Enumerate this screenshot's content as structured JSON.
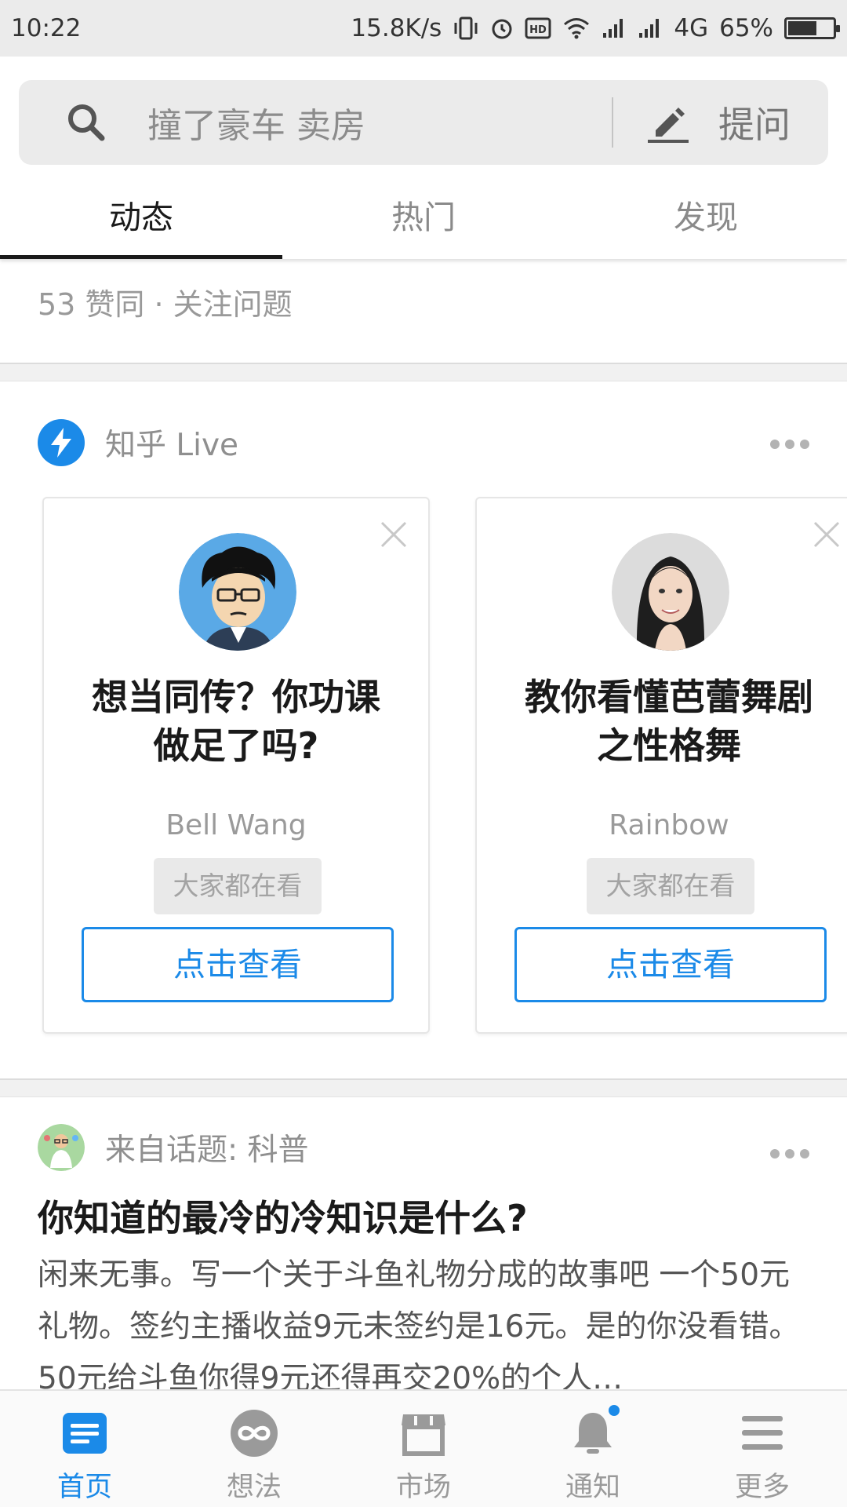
{
  "status_bar": {
    "time": "10:22",
    "speed": "15.8K/s",
    "network": "4G",
    "battery": "65%",
    "battery_level": 0.65
  },
  "search": {
    "placeholder": "撞了豪车 卖房",
    "ask_label": "提问"
  },
  "tabs": [
    {
      "label": "动态",
      "active": true
    },
    {
      "label": "热门",
      "active": false
    },
    {
      "label": "发现",
      "active": false
    }
  ],
  "prev_item": {
    "meta": "53 赞同 · 关注问题"
  },
  "live": {
    "section_title": "知乎 Live",
    "cards": [
      {
        "title_line1": "想当同传？你功课",
        "title_line2": "做足了吗?",
        "author": "Bell Wang",
        "badge": "大家都在看",
        "cta": "点击查看"
      },
      {
        "title_line1": "教你看懂芭蕾舞剧",
        "title_line2": "之性格舞",
        "author": "Rainbow",
        "badge": "大家都在看",
        "cta": "点击查看"
      }
    ]
  },
  "topic_item": {
    "source": "来自话题: 科普",
    "question": "你知道的最冷的冷知识是什么?",
    "excerpt": "闲来无事。写一个关于斗鱼礼物分成的故事吧 一个50元礼物。签约主播收益9元未签约是16元。是的你没看错。50元给斗鱼你得9元还得再交20%的个人…"
  },
  "bottom_nav": [
    {
      "label": "首页",
      "icon": "home-feed-icon",
      "active": true
    },
    {
      "label": "想法",
      "icon": "ideas-icon",
      "active": false
    },
    {
      "label": "市场",
      "icon": "market-icon",
      "active": false
    },
    {
      "label": "通知",
      "icon": "bell-icon",
      "active": false
    },
    {
      "label": "更多",
      "icon": "menu-icon",
      "active": false
    }
  ],
  "colors": {
    "accent": "#1b8ae8",
    "muted": "#9a9a9a",
    "status_bar_bg": "#ebebeb"
  }
}
